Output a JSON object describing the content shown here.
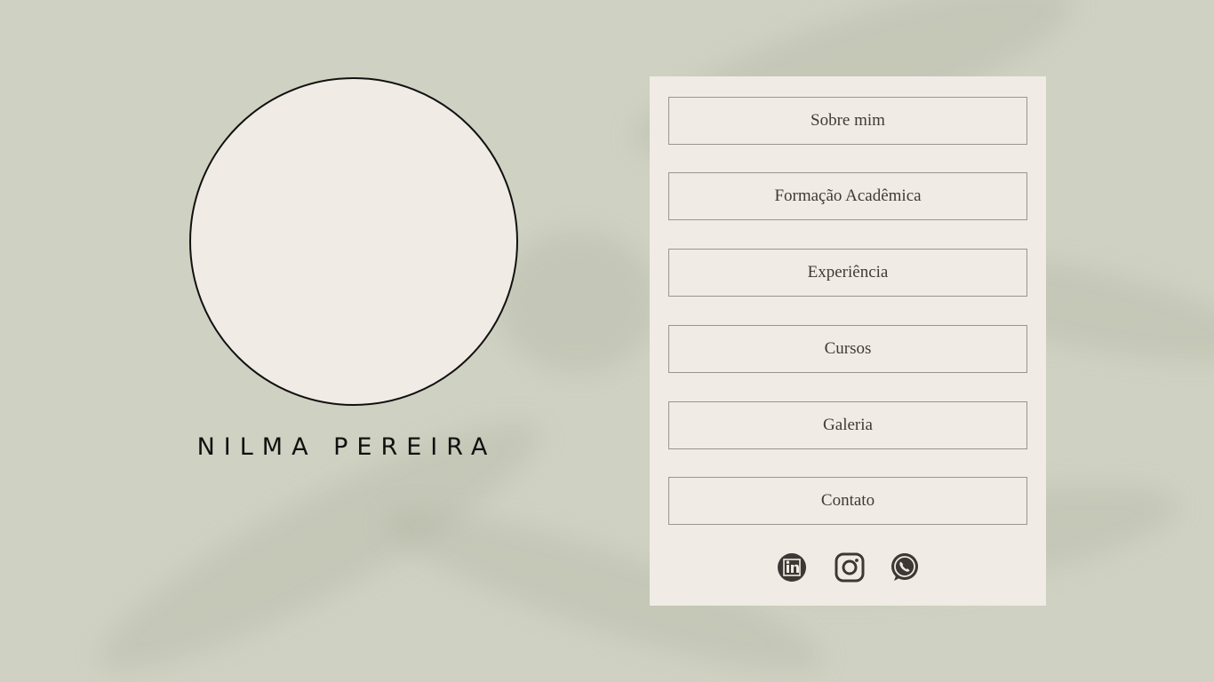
{
  "profile": {
    "name": "NILMA PEREIRA"
  },
  "menu": {
    "items": [
      {
        "label": "Sobre mim"
      },
      {
        "label": "Formação Acadêmica"
      },
      {
        "label": "Experiência"
      },
      {
        "label": "Cursos"
      },
      {
        "label": "Galeria"
      },
      {
        "label": "Contato"
      }
    ]
  },
  "social": [
    {
      "icon": "linkedin-icon"
    },
    {
      "icon": "instagram-icon"
    },
    {
      "icon": "whatsapp-icon"
    }
  ],
  "colors": {
    "background": "#cfd1c2",
    "panel": "#f0ebe5",
    "text": "#3e3b37",
    "icon": "#3d3833"
  }
}
